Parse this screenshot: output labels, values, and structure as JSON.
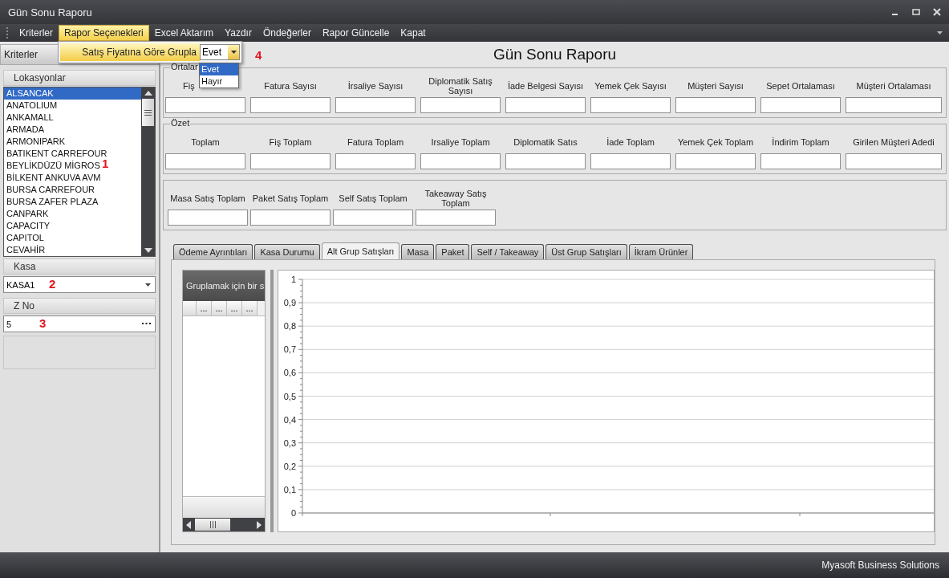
{
  "window": {
    "title": "Gün Sonu Raporu"
  },
  "menu": [
    {
      "label": "Kriterler",
      "selected": false
    },
    {
      "label": "Rapor Seçenekleri",
      "selected": true
    },
    {
      "label": "Excel Aktarım",
      "selected": false
    },
    {
      "label": "Yazdır",
      "selected": false
    },
    {
      "label": "Öndeğerler",
      "selected": false
    },
    {
      "label": "Rapor Güncelle",
      "selected": false
    },
    {
      "label": "Kapat",
      "selected": false
    }
  ],
  "menu_popup": {
    "label": "Satış Fiyatına Göre Grupla",
    "value": "Evet",
    "options": [
      {
        "label": "Evet",
        "selected": true
      },
      {
        "label": "Hayır",
        "selected": false
      }
    ]
  },
  "left_panel": {
    "header": "Kriterler",
    "locations": {
      "title": "Lokasyonlar",
      "items": [
        {
          "label": "ALSANCAK",
          "selected": true
        },
        {
          "label": "ANATOLIUM",
          "selected": false
        },
        {
          "label": "ANKAMALL",
          "selected": false
        },
        {
          "label": "ARMADA",
          "selected": false
        },
        {
          "label": "ARMONIPARK",
          "selected": false
        },
        {
          "label": "BATIKENT CARREFOUR",
          "selected": false
        },
        {
          "label": "BEYLİKDÜZÜ MİGROS",
          "selected": false
        },
        {
          "label": "BİLKENT ANKUVA AVM",
          "selected": false
        },
        {
          "label": "BURSA CARREFOUR",
          "selected": false
        },
        {
          "label": "BURSA ZAFER PLAZA",
          "selected": false
        },
        {
          "label": "CANPARK",
          "selected": false
        },
        {
          "label": "CAPACITY",
          "selected": false
        },
        {
          "label": "CAPITOL",
          "selected": false
        },
        {
          "label": "CEVAHİR",
          "selected": false
        }
      ]
    },
    "kasa": {
      "title": "Kasa",
      "value": "KASA1"
    },
    "z_no": {
      "title": "Z No",
      "value": "5"
    }
  },
  "annotations": [
    "1",
    "2",
    "3",
    "4"
  ],
  "report_title": "Gün Sonu Raporu",
  "averages": {
    "legend": "Ortalar",
    "fields": [
      "Fiş",
      "Fatura Sayısı",
      "İrsaliye Sayısı",
      "Diplomatik Satış Sayısı",
      "İade Belgesi Sayısı",
      "Yemek Çek Sayısı",
      "Müşteri Sayısı",
      "Sepet Ortalaması",
      "Müşteri Ortalaması"
    ]
  },
  "summary": {
    "legend": "Özet",
    "fields": [
      "Toplam",
      "Fiş Toplam",
      "Fatura Toplam",
      "Irsaliye Toplam",
      "Diplomatik Satıs",
      "İade Toplam",
      "Yemek Çek Toplam",
      "İndirim Toplam",
      "Girilen Müşteri Adedi"
    ]
  },
  "sales": {
    "fields": [
      "Masa Satış Toplam",
      "Paket Satış Toplam",
      "Self Satış Toplam",
      "Takeaway Satış Toplam"
    ]
  },
  "tabs": [
    {
      "label": "Ödeme Ayrıntıları",
      "selected": false
    },
    {
      "label": "Kasa Durumu",
      "selected": false
    },
    {
      "label": "Alt Grup Satışları",
      "selected": true
    },
    {
      "label": "Masa",
      "selected": false
    },
    {
      "label": "Paket",
      "selected": false
    },
    {
      "label": "Self / Takeaway",
      "selected": false
    },
    {
      "label": "Üst Grup Satışları",
      "selected": false
    },
    {
      "label": "İkram Ürünler",
      "selected": false
    }
  ],
  "grid": {
    "group_prompt": "Gruplamak için bir s",
    "columns": [
      "...",
      "...",
      "...",
      "..."
    ]
  },
  "chart": {
    "chart_data": {
      "type": "bar",
      "grid": true,
      "categories": [
        null,
        null
      ],
      "values": [
        null,
        null
      ],
      "ylim": [
        0,
        1
      ],
      "yticks": [
        {
          "value": 0,
          "label": "0"
        },
        {
          "value": 0.1,
          "label": "0,1"
        },
        {
          "value": 0.2,
          "label": "0,2"
        },
        {
          "value": 0.3,
          "label": "0,3"
        },
        {
          "value": 0.4,
          "label": "0,4"
        },
        {
          "value": 0.5,
          "label": "0,5"
        },
        {
          "value": 0.6,
          "label": "0,6"
        },
        {
          "value": 0.7,
          "label": "0,7"
        },
        {
          "value": 0.8,
          "label": "0,8"
        },
        {
          "value": 0.9,
          "label": "0,9"
        },
        {
          "value": 1,
          "label": "1"
        }
      ]
    }
  },
  "status_bar": "Myasoft Business Solutions"
}
